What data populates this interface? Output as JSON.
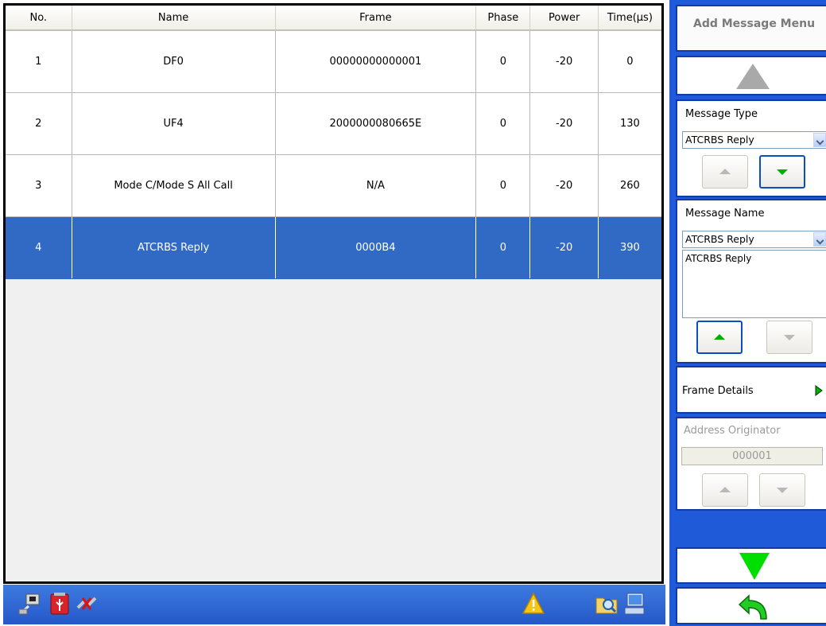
{
  "table": {
    "columns": [
      "No.",
      "Name",
      "Frame",
      "Phase",
      "Power",
      "Time(µs)"
    ],
    "rows": [
      {
        "no": "1",
        "name": "DF0",
        "frame": "00000000000001",
        "phase": "0",
        "power": "-20",
        "time": "0"
      },
      {
        "no": "2",
        "name": "UF4",
        "frame": "2000000080665E",
        "phase": "0",
        "power": "-20",
        "time": "130"
      },
      {
        "no": "3",
        "name": "Mode C/Mode S All Call",
        "frame": "N/A",
        "phase": "0",
        "power": "-20",
        "time": "260"
      },
      {
        "no": "4",
        "name": "ATCRBS Reply",
        "frame": "0000B4",
        "phase": "0",
        "power": "-20",
        "time": "390"
      }
    ],
    "selected_row": "4"
  },
  "panel": {
    "title": "Add Message Menu",
    "message_type": {
      "label": "Message Type",
      "value": "ATCRBS Reply"
    },
    "message_name": {
      "label": "Message Name",
      "value": "ATCRBS Reply",
      "text": "ATCRBS Reply"
    },
    "frame_details": {
      "label": "Frame Details"
    },
    "address_originator": {
      "label": "Address Originator",
      "value": "000001"
    }
  },
  "status_icons": [
    "network-icon",
    "usb-icon",
    "plug-disconnected-icon",
    "warning-icon",
    "search-folder-icon",
    "computer-keyboard-icon"
  ],
  "colors": {
    "selection": "#316ac5",
    "panel_blue": "#1f5bd8",
    "accent_green": "#00c000"
  }
}
